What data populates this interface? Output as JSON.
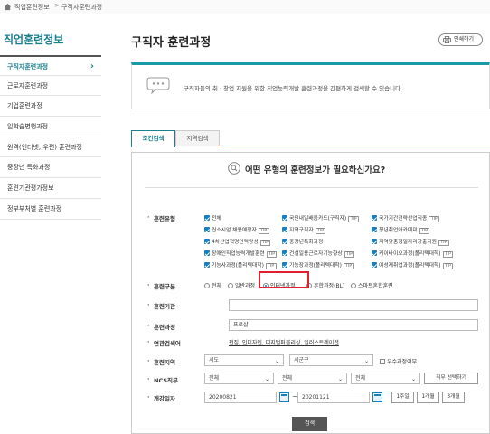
{
  "breadcrumb": {
    "first": "직업훈련정보",
    "second": "구직자훈련과정"
  },
  "sidebar": {
    "title": "직업훈련정보",
    "items": [
      {
        "label": "구직자훈련과정",
        "active": true
      },
      {
        "label": "근로자훈련과정"
      },
      {
        "label": "기업훈련과정"
      },
      {
        "label": "일학습병행과정"
      },
      {
        "label": "원격(인터넷, 우편) 훈련과정"
      },
      {
        "label": "중장년 특화과정"
      },
      {
        "label": "훈련기관평가정보"
      },
      {
        "label": "정부부처별 훈련과정"
      }
    ]
  },
  "main": {
    "title": "구직자 훈련과정",
    "print_label": "인쇄하기",
    "info_text": "구직자들의 취 · 창업 지원을 위한 직업능력개발 훈련과정을 간편하게 검색할 수 있습니다.",
    "tabs": [
      {
        "label": "조건검색",
        "active": true
      },
      {
        "label": "지역검색"
      }
    ]
  },
  "form": {
    "question": "어떤 유형의 훈련정보가 필요하신가요?",
    "labels": {
      "type": "훈련유형",
      "category": "훈련구분",
      "institution": "훈련기관",
      "course": "훈련과정",
      "related": "연관검색어",
      "region": "훈련지역",
      "ncs": "NCS직무",
      "date": "개강일자"
    },
    "types": [
      {
        "label": "전체",
        "tip": false
      },
      {
        "label": "국민내일배움카드(구직자)",
        "tip": true
      },
      {
        "label": "국가기간전략산업직종",
        "tip": true
      },
      {
        "label": "컨소시엄 채용예정자",
        "tip": true
      },
      {
        "label": "지역구직자",
        "tip": true
      },
      {
        "label": "청년취업아카데미",
        "tip": true
      },
      {
        "label": "4차산업혁명인력양성",
        "tip": true
      },
      {
        "label": "중장년특화과정",
        "tip": false
      },
      {
        "label": "지역맞춤형일자리창출지원",
        "tip": true
      },
      {
        "label": "장애인직업능력개발훈련",
        "tip": true
      },
      {
        "label": "건설일용근로자기능향상",
        "tip": true
      },
      {
        "label": "케이바이오과정(폴리텍대학)",
        "tip": true
      },
      {
        "label": "기능사과정(폴리텍대학)",
        "tip": true
      },
      {
        "label": "기능장과정(폴리텍대학)",
        "tip": true
      },
      {
        "label": "여성재취업과정(폴리텍대학)",
        "tip": true
      }
    ],
    "categories": [
      {
        "label": "전체",
        "checked": false
      },
      {
        "label": "일반과정",
        "checked": false
      },
      {
        "label": "인터넷과정",
        "checked": true
      },
      {
        "label": "혼합과정(BL)",
        "checked": false
      },
      {
        "label": "스마트혼합훈련",
        "checked": false
      }
    ],
    "institution_value": "",
    "course_value": "프로샵",
    "related_terms": "편집, 인디자인, 디지털퍼블리싱, 일러스트레이션",
    "region": {
      "sido": "시도",
      "sigungu": "시군구",
      "excellent_label": "우수과정여부"
    },
    "ncs": {
      "sel1": "전체",
      "sel2": "전체",
      "sel3": "전체",
      "button": "직무 선택하기"
    },
    "date": {
      "from": "20200821",
      "to": "20201121",
      "tilde": "~",
      "btn1": "1주일",
      "btn2": "1개월",
      "btn3": "3개월"
    },
    "search_label": "검색"
  },
  "colors": {
    "accent": "#1a7f8e",
    "checkbox": "#1a7fbe",
    "highlight": "#e02030"
  }
}
